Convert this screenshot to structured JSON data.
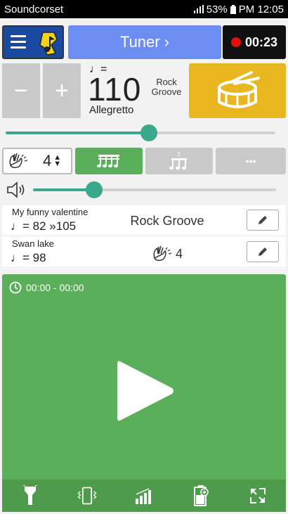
{
  "status_bar": {
    "app_name": "Soundcorset",
    "battery": "53%",
    "time": "PM 12:05"
  },
  "header": {
    "tuner_label": "Tuner ›",
    "timer": "00:23"
  },
  "tempo": {
    "minus_label": "−",
    "plus_label": "+",
    "note_label": "♩=",
    "bpm": "110",
    "tempo_name": "Allegretto",
    "rhythm_line1": "Rock",
    "rhythm_line2": "Groove",
    "slider_level": 0.53
  },
  "mode": {
    "beats": "4",
    "more_label": "•••",
    "triplet_label": "3"
  },
  "volume": {
    "level": 0.25
  },
  "songs": [
    {
      "title": "My funny valentine",
      "tempo": "♩= 82 »105",
      "rhythm": "Rock Groove"
    },
    {
      "title": "Swan lake",
      "tempo": "♩= 98",
      "beats": "4"
    }
  ],
  "player": {
    "session_time": "00:00 - 00:00"
  },
  "colors": {
    "accent": "#3aa88c",
    "play_panel": "#5caf5a",
    "drum": "#e8b71f",
    "tuner": "#6c8ef3",
    "menu": "#1a4aa0"
  },
  "icons": [
    "hamburger-icon",
    "logo-icon",
    "record-icon",
    "drum-icon",
    "hand-icon",
    "sixteenth-notes-icon",
    "triplet-icon",
    "speaker-icon",
    "pencil-icon",
    "clock-icon",
    "play-icon",
    "flashlight-icon",
    "vibrate-icon",
    "signal-bars-icon",
    "battery-plus-icon",
    "fullscreen-icon"
  ]
}
